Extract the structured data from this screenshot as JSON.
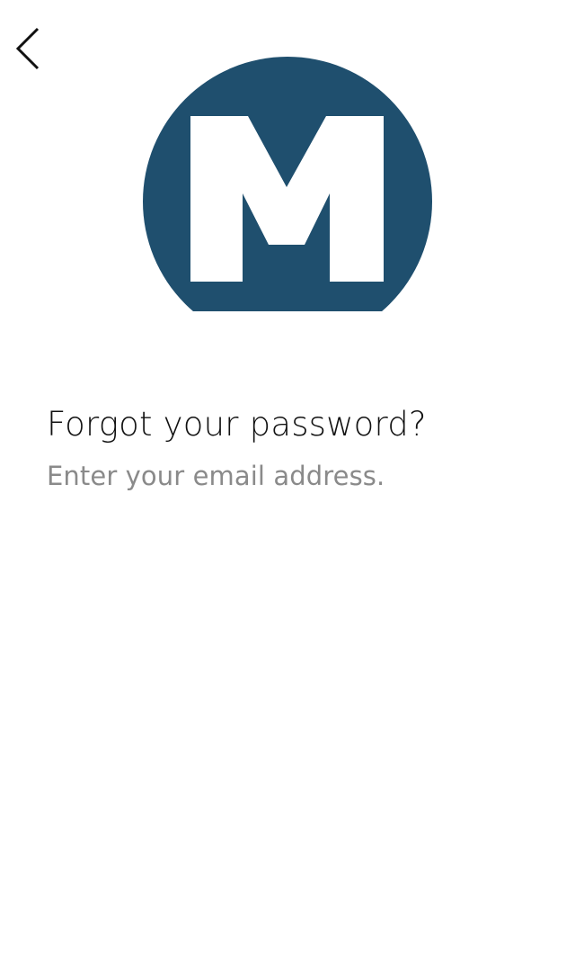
{
  "colors": {
    "logo_background": "#1f4f6e",
    "logo_letter": "#ffffff",
    "title_text": "#111111",
    "subtitle_text": "#8a8a8a"
  },
  "header": {
    "back_icon": "chevron-left-icon"
  },
  "logo": {
    "letter": "M"
  },
  "content": {
    "title": "Forgot your password?",
    "subtitle": "Enter your email address."
  }
}
